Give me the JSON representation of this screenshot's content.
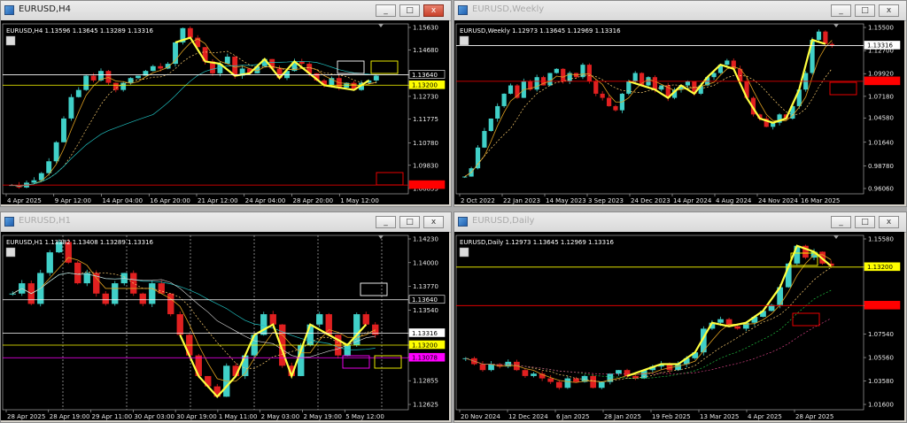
{
  "windows": [
    {
      "id": "h4",
      "title": "EURUSD,H4",
      "active": true,
      "header": "EURUSD,H4  1.13596 1.13645 1.13289 1.13316",
      "price_labels": [
        "1.15630",
        "1.14680",
        "1.13640",
        "1.13200",
        "1.12730",
        "1.11775",
        "1.10780",
        "1.09830",
        "1.08855"
      ],
      "time_labels": [
        "4 Apr 2025",
        "9 Apr 12:00",
        "14 Apr 04:00",
        "16 Apr 20:00",
        "21 Apr 12:00",
        "24 Apr 04:00",
        "28 Apr 20:00",
        "1 May 12:00"
      ],
      "badges": [
        {
          "text": "1.13640",
          "bg": "#000000",
          "fg": "#ffffff",
          "border": "#ffffff"
        },
        {
          "text": "1.13200",
          "bg": "#ffff00",
          "fg": "#000000",
          "border": "#ffff00"
        },
        {
          "text": "1.09000",
          "bg": "#ff0000",
          "fg": "#ff0000",
          "border": "#ff0000"
        }
      ],
      "close_prices": [
        1.09,
        1.089,
        1.091,
        1.092,
        1.095,
        1.1,
        1.108,
        1.118,
        1.127,
        1.13,
        1.136,
        1.134,
        1.138,
        1.133,
        1.13,
        1.133,
        1.135,
        1.136,
        1.138,
        1.14,
        1.139,
        1.141,
        1.15,
        1.156,
        1.152,
        1.148,
        1.142,
        1.137,
        1.141,
        1.144,
        1.136,
        1.139,
        1.137,
        1.14,
        1.143,
        1.139,
        1.135,
        1.138,
        1.142,
        1.141,
        1.137,
        1.134,
        1.132,
        1.135,
        1.131,
        1.133,
        1.13,
        1.133,
        1.134,
        1.136
      ]
    },
    {
      "id": "weekly",
      "title": "EURUSD,Weekly",
      "active": false,
      "header": "EURUSD,Weekly  1.12973 1.13645 1.12969 1.13316",
      "price_labels": [
        "1.15500",
        "1.12700",
        "1.09920",
        "1.07180",
        "1.04580",
        "1.01640",
        "0.98780",
        "0.96060"
      ],
      "time_labels": [
        "2 Oct 2022",
        "22 Jan 2023",
        "14 May 2023",
        "3 Sep 2023",
        "24 Dec 2023",
        "14 Apr 2024",
        "4 Aug 2024",
        "24 Nov 2024",
        "16 Mar 2025"
      ],
      "badges": [
        {
          "text": "1.13316",
          "bg": "#ffffff",
          "fg": "#000000",
          "border": "#ffffff"
        },
        {
          "text": "1.09000",
          "bg": "#ff0000",
          "fg": "#ff0000",
          "border": "#ff0000"
        }
      ],
      "close_prices": [
        0.975,
        0.985,
        1.01,
        1.03,
        1.045,
        1.06,
        1.075,
        1.085,
        1.07,
        1.09,
        1.08,
        1.095,
        1.085,
        1.1,
        1.105,
        1.09,
        1.1,
        1.095,
        1.11,
        1.09,
        1.075,
        1.07,
        1.06,
        1.055,
        1.075,
        1.09,
        1.1,
        1.085,
        1.095,
        1.08,
        1.085,
        1.07,
        1.08,
        1.085,
        1.09,
        1.075,
        1.085,
        1.095,
        1.1,
        1.11,
        1.115,
        1.105,
        1.09,
        1.07,
        1.05,
        1.045,
        1.035,
        1.04,
        1.05,
        1.045,
        1.06,
        1.08,
        1.1,
        1.14,
        1.15,
        1.135,
        1.133
      ]
    },
    {
      "id": "h1",
      "title": "EURUSD,H1",
      "active": false,
      "header": "EURUSD,H1  1.13382 1.13408 1.13289 1.13316",
      "price_labels": [
        "1.14230",
        "1.14000",
        "1.13770",
        "1.13540",
        "1.13316",
        "1.13200",
        "1.13085",
        "1.12855",
        "1.12625"
      ],
      "time_labels": [
        "28 Apr 2025",
        "28 Apr 19:00",
        "29 Apr 11:00",
        "30 Apr 03:00",
        "30 Apr 19:00",
        "1 May 11:00",
        "2 May 03:00",
        "2 May 19:00",
        "5 May 12:00"
      ],
      "badges": [
        {
          "text": "1.13640",
          "bg": "#000000",
          "fg": "#ffffff",
          "border": "#ffffff"
        },
        {
          "text": "1.13316",
          "bg": "#ffffff",
          "fg": "#000000",
          "border": "#ffffff"
        },
        {
          "text": "1.13200",
          "bg": "#ffff00",
          "fg": "#000000",
          "border": "#ffff00"
        },
        {
          "text": "1.13078",
          "bg": "#ff00ff",
          "fg": "#000000",
          "border": "#ff00ff"
        }
      ],
      "close_prices": [
        1.137,
        1.138,
        1.136,
        1.139,
        1.141,
        1.142,
        1.14,
        1.138,
        1.139,
        1.137,
        1.136,
        1.138,
        1.139,
        1.137,
        1.136,
        1.138,
        1.137,
        1.135,
        1.133,
        1.131,
        1.129,
        1.128,
        1.127,
        1.13,
        1.129,
        1.131,
        1.133,
        1.135,
        1.134,
        1.13,
        1.129,
        1.132,
        1.134,
        1.135,
        1.133,
        1.131,
        1.132,
        1.135,
        1.134,
        1.133
      ]
    },
    {
      "id": "daily",
      "title": "EURUSD,Daily",
      "active": false,
      "header": "EURUSD,Daily  1.12973 1.13645 1.12969 1.13316",
      "price_labels": [
        "1.15580",
        "1.13200",
        "1.09950",
        "1.07540",
        "1.05560",
        "1.03580",
        "1.01600"
      ],
      "time_labels": [
        "20 Nov 2024",
        "12 Dec 2024",
        "6 Jan 2025",
        "28 Jan 2025",
        "19 Feb 2025",
        "13 Mar 2025",
        "4 Apr 2025",
        "28 Apr 2025"
      ],
      "badges": [
        {
          "text": "1.13200",
          "bg": "#ffff00",
          "fg": "#000000",
          "border": "#ffff00"
        },
        {
          "text": "1.09950",
          "bg": "#ff0000",
          "fg": "#ff0000",
          "border": "#ff0000"
        }
      ],
      "close_prices": [
        1.055,
        1.05,
        1.045,
        1.05,
        1.048,
        1.052,
        1.045,
        1.04,
        1.042,
        1.038,
        1.035,
        1.03,
        1.038,
        1.035,
        1.04,
        1.03,
        1.035,
        1.042,
        1.045,
        1.04,
        1.038,
        1.045,
        1.048,
        1.05,
        1.045,
        1.05,
        1.055,
        1.06,
        1.08,
        1.085,
        1.088,
        1.082,
        1.08,
        1.085,
        1.09,
        1.095,
        1.1,
        1.115,
        1.135,
        1.15,
        1.14,
        1.145,
        1.135,
        1.133
      ]
    }
  ]
}
